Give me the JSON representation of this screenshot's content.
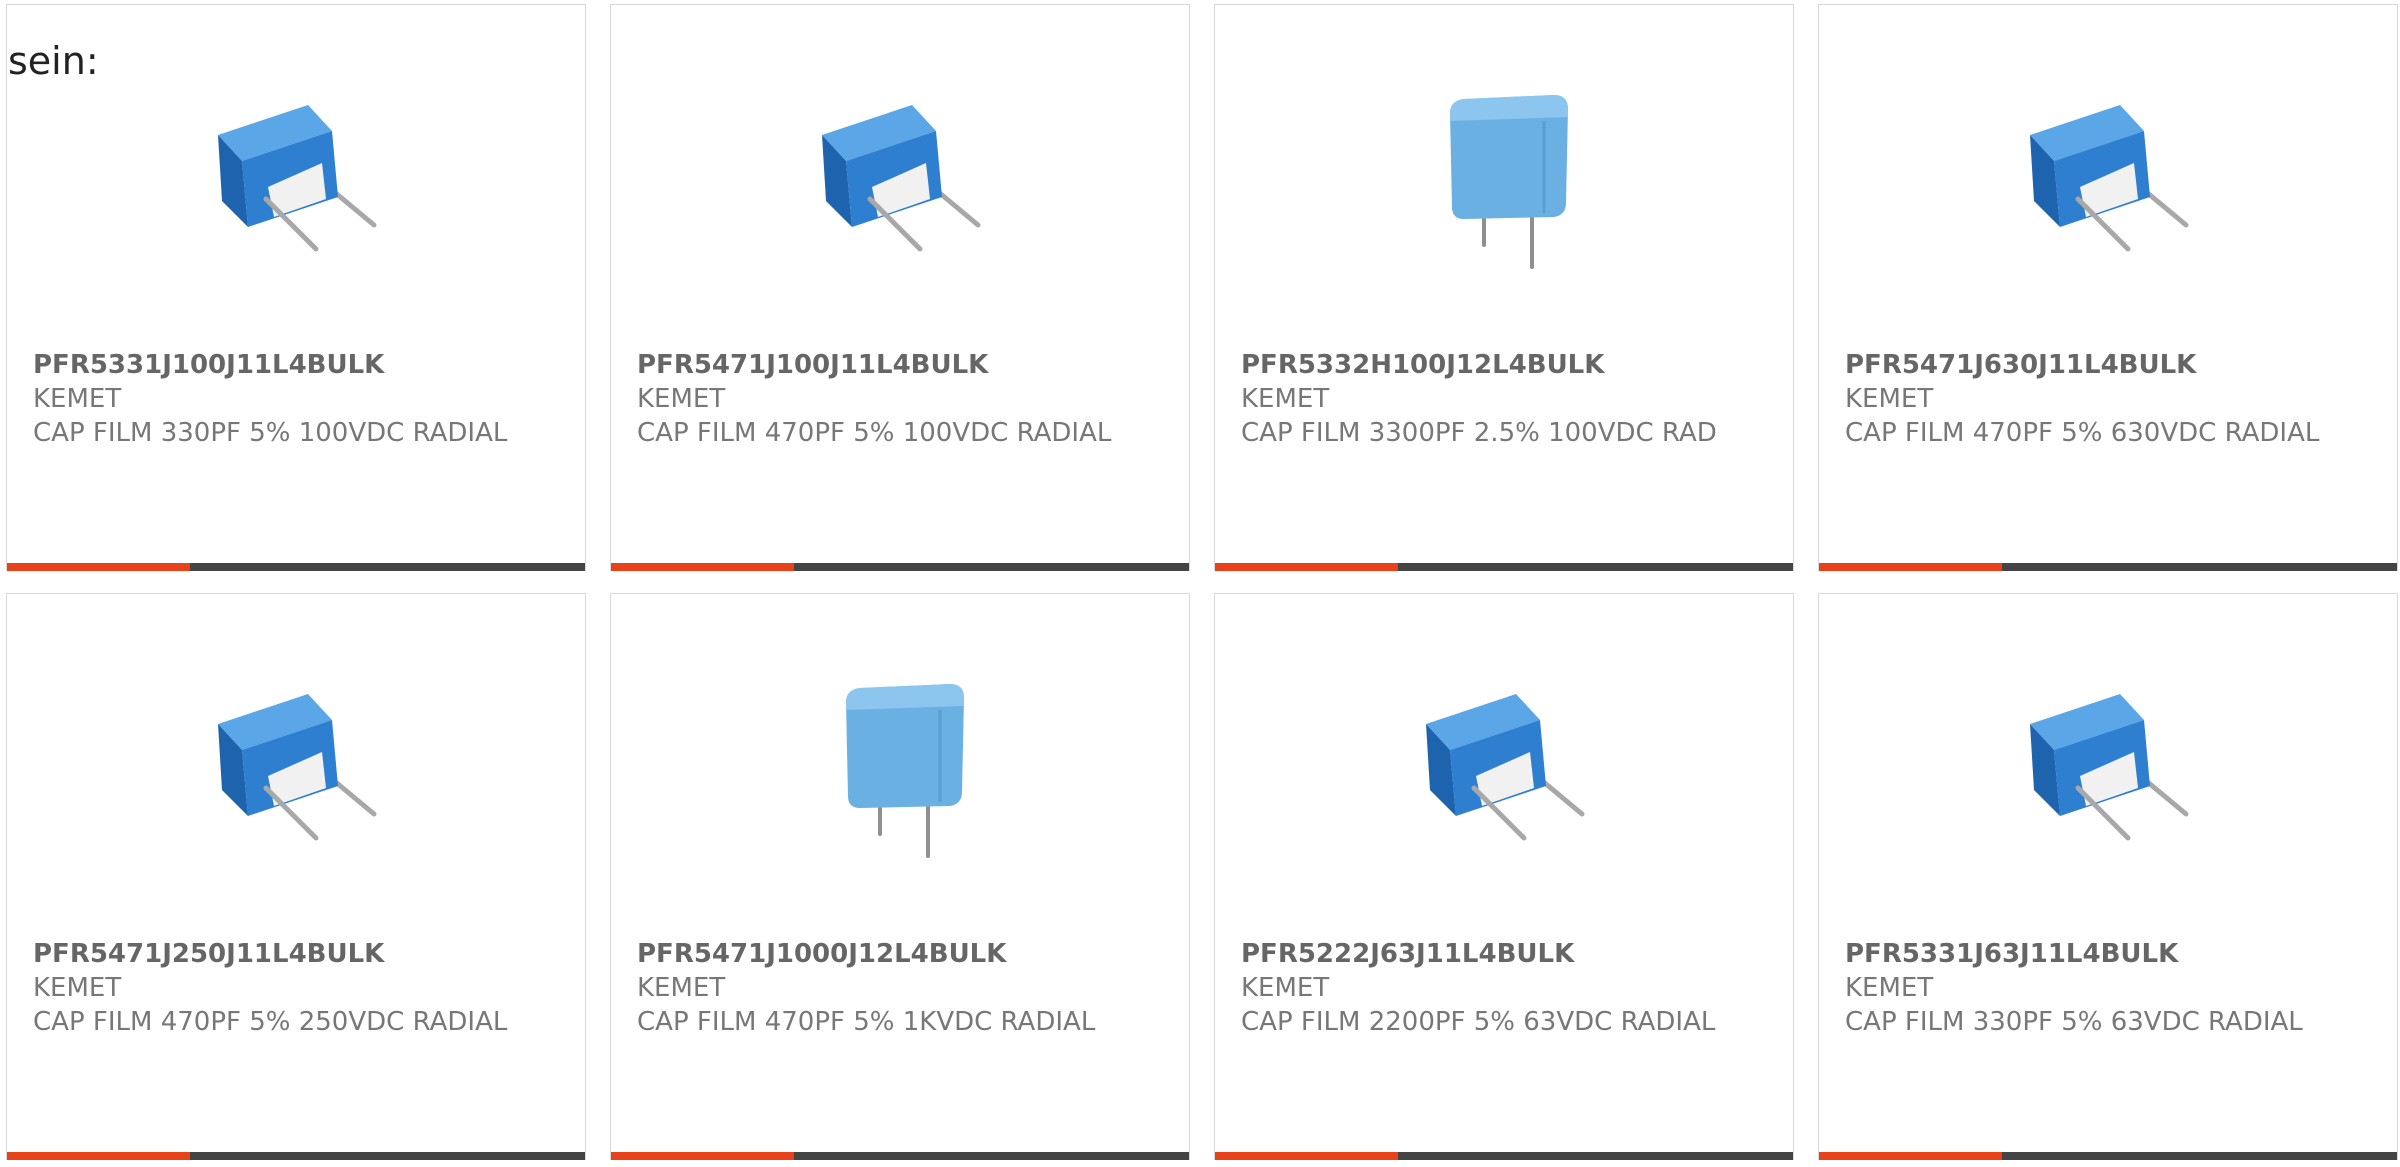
{
  "intro_text": "sein:",
  "colors": {
    "accent": "#e8421a",
    "bar": "#444444",
    "card_border": "#d9d9d9",
    "text": "#777777",
    "capacitor_angled": "#2f7fd0",
    "capacitor_boxed": "#6ab0e2"
  },
  "products": [
    {
      "part_number": "PFR5331J100J11L4BULK",
      "manufacturer": "KEMET",
      "description": "CAP FILM 330PF 5% 100VDC RADIAL",
      "image_icon": "film-capacitor-angled-icon"
    },
    {
      "part_number": "PFR5471J100J11L4BULK",
      "manufacturer": "KEMET",
      "description": "CAP FILM 470PF 5% 100VDC RADIAL",
      "image_icon": "film-capacitor-angled-icon"
    },
    {
      "part_number": "PFR5332H100J12L4BULK",
      "manufacturer": "KEMET",
      "description": "CAP FILM 3300PF 2.5% 100VDC RAD",
      "image_icon": "film-capacitor-boxed-icon"
    },
    {
      "part_number": "PFR5471J630J11L4BULK",
      "manufacturer": "KEMET",
      "description": "CAP FILM 470PF 5% 630VDC RADIAL",
      "image_icon": "film-capacitor-angled-icon"
    },
    {
      "part_number": "PFR5471J250J11L4BULK",
      "manufacturer": "KEMET",
      "description": "CAP FILM 470PF 5% 250VDC RADIAL",
      "image_icon": "film-capacitor-angled-icon"
    },
    {
      "part_number": "PFR5471J1000J12L4BULK",
      "manufacturer": "KEMET",
      "description": "CAP FILM 470PF 5% 1KVDC RADIAL",
      "image_icon": "film-capacitor-boxed-icon"
    },
    {
      "part_number": "PFR5222J63J11L4BULK",
      "manufacturer": "KEMET",
      "description": "CAP FILM 2200PF 5% 63VDC RADIAL",
      "image_icon": "film-capacitor-angled-icon"
    },
    {
      "part_number": "PFR5331J63J11L4BULK",
      "manufacturer": "KEMET",
      "description": "CAP FILM 330PF 5% 63VDC RADIAL",
      "image_icon": "film-capacitor-angled-icon"
    }
  ]
}
